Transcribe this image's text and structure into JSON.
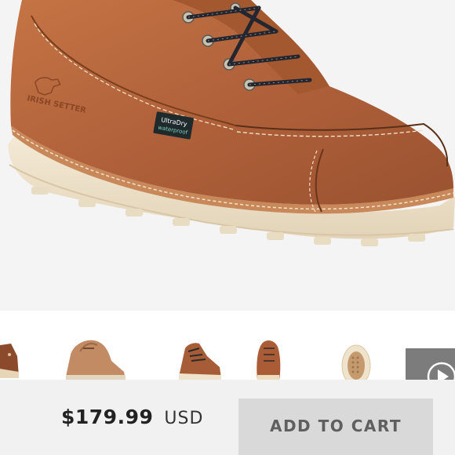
{
  "product": {
    "image_icon": "work-boot-image",
    "brand_logo_text": "IRISH SETTER",
    "tag_text_line1": "UltraDry",
    "tag_text_line2": "waterproof"
  },
  "thumbnails": [
    {
      "icon": "boot-side-thumbnail"
    },
    {
      "icon": "boot-heel-thumbnail"
    },
    {
      "icon": "boot-angle-thumbnail"
    },
    {
      "icon": "boot-front-thumbnail"
    },
    {
      "icon": "boot-sole-thumbnail"
    },
    {
      "icon": "video-play-thumbnail"
    }
  ],
  "purchase": {
    "price": "$179.99",
    "currency": "USD",
    "add_to_cart_label": "ADD TO CART"
  },
  "colors": {
    "leather": "#b2643a",
    "sole": "#efe3cc",
    "button_bg": "#d9d9d9",
    "button_text": "#5f5f5f"
  }
}
